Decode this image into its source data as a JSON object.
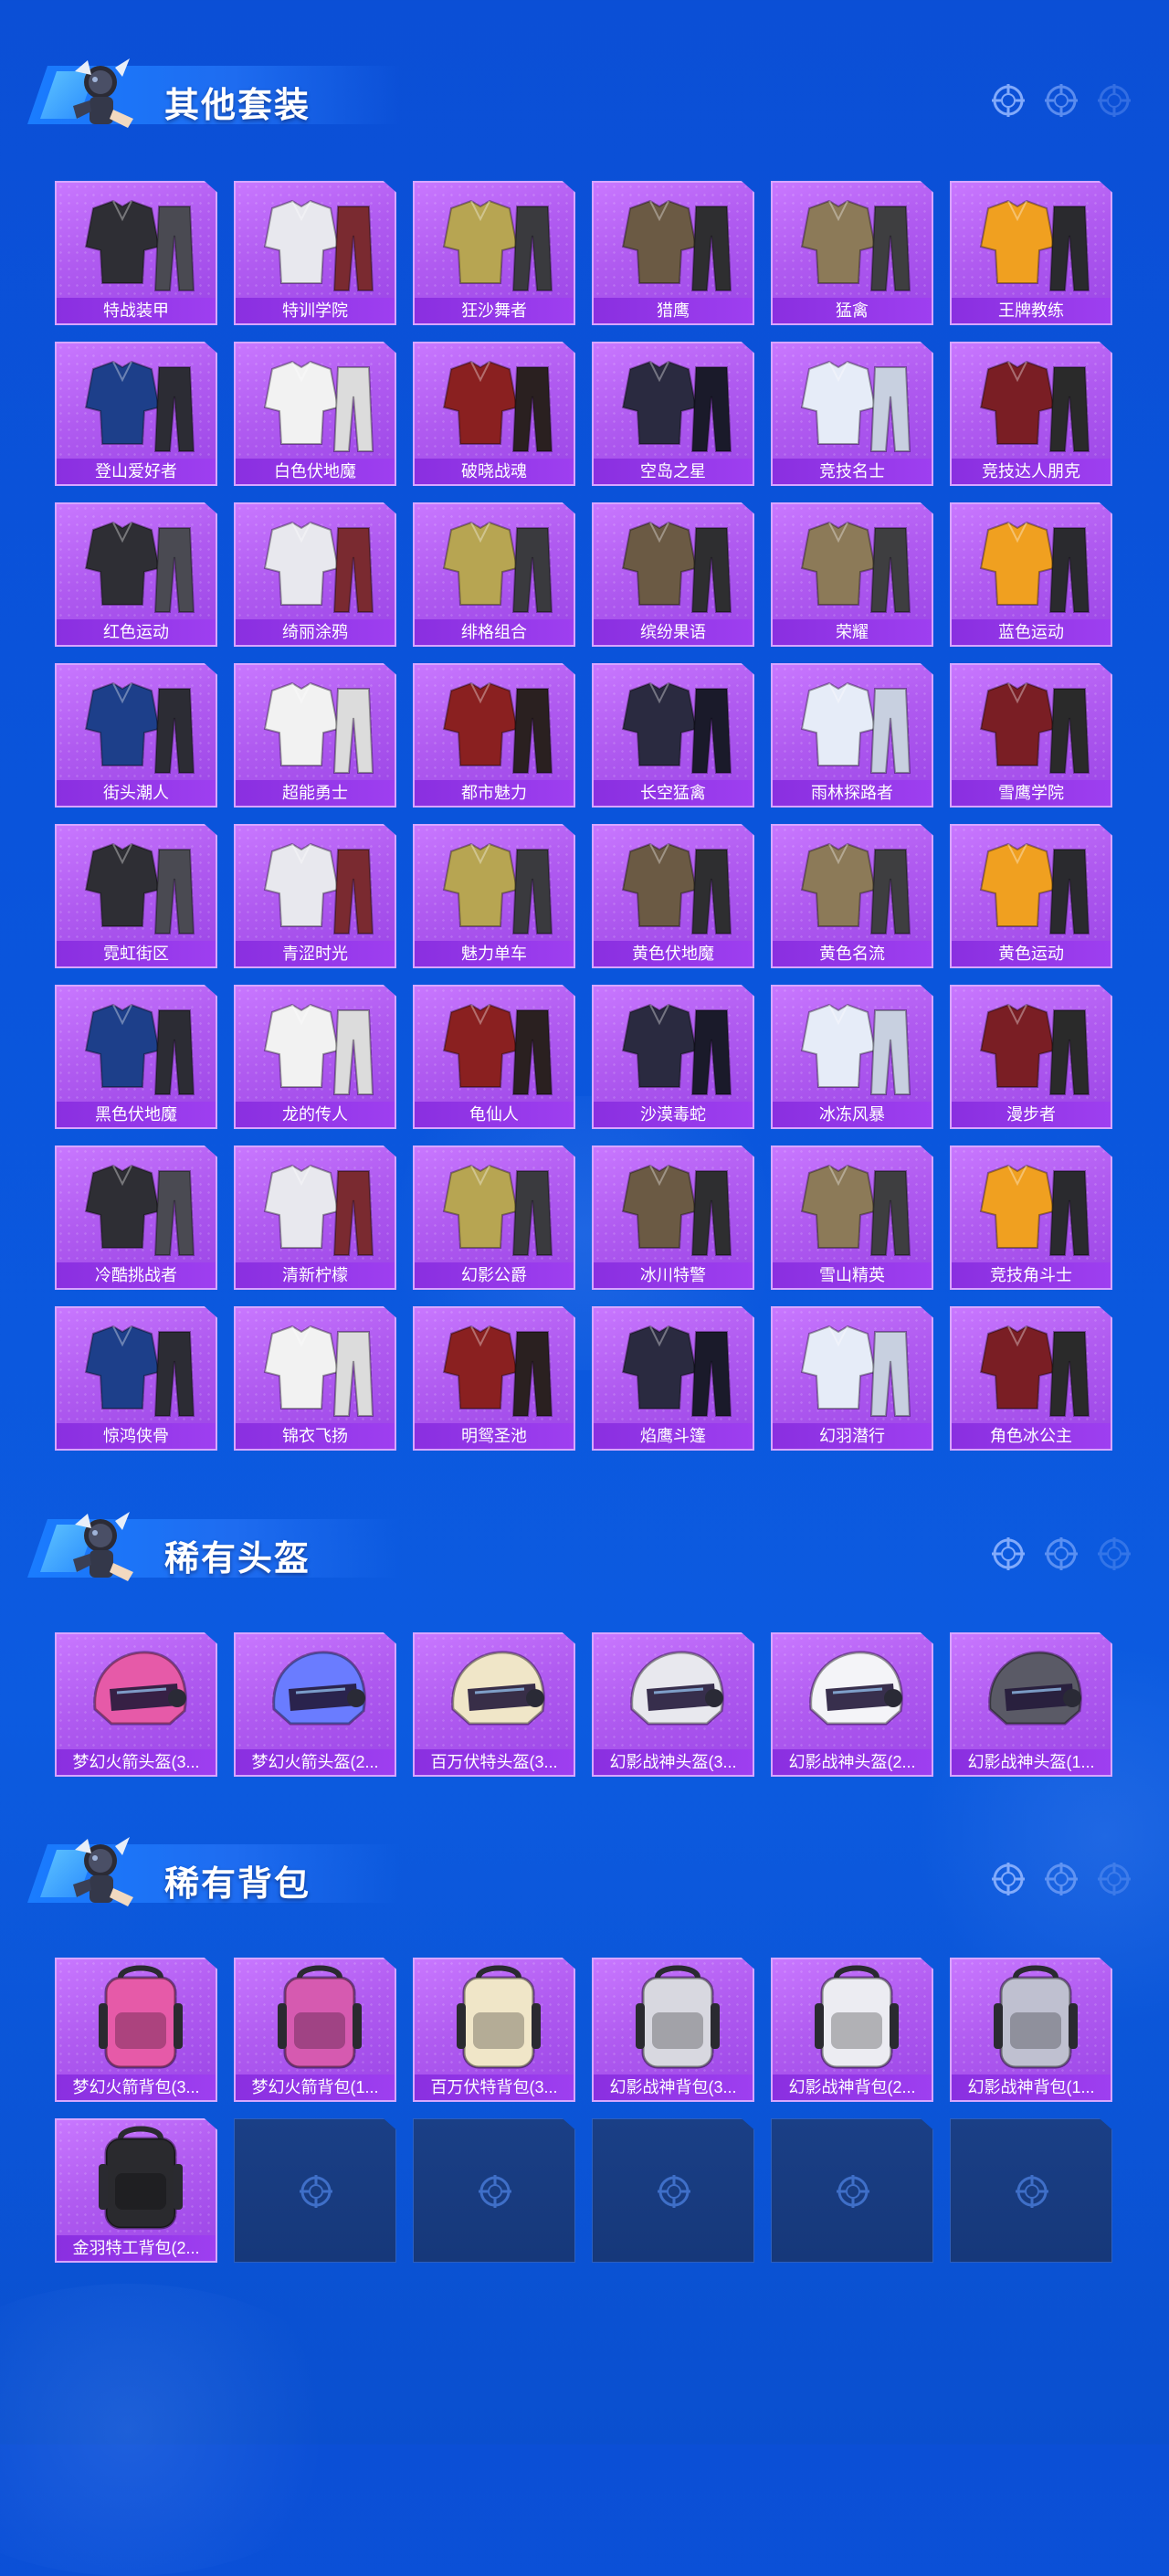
{
  "sections": [
    {
      "title": "其他套装",
      "items": [
        "特战装甲",
        "特训学院",
        "狂沙舞者",
        "猎鹰",
        "猛禽",
        "王牌教练",
        "登山爱好者",
        "白色伏地魔",
        "破晓战魂",
        "空岛之星",
        "竞技名士",
        "竞技达人朋克",
        "红色运动",
        "绮丽涂鸦",
        "绯格组合",
        "缤纷果语",
        "荣耀",
        "蓝色运动",
        "街头潮人",
        "超能勇士",
        "都市魅力",
        "长空猛禽",
        "雨林探路者",
        "雪鹰学院",
        "霓虹街区",
        "青涩时光",
        "魅力单车",
        "黄色伏地魔",
        "黄色名流",
        "黄色运动",
        "黑色伏地魔",
        "龙的传人",
        "龟仙人",
        "沙漠毒蛇",
        "冰冻风暴",
        "漫步者",
        "冷酷挑战者",
        "清新柠檬",
        "幻影公爵",
        "冰川特警",
        "雪山精英",
        "竞技角斗士",
        "惊鸿侠骨",
        "锦衣飞扬",
        "明鸳圣池",
        "焰鹰斗篷",
        "幻羽潜行",
        "角色冰公主"
      ]
    },
    {
      "title": "稀有头盔",
      "items": [
        "梦幻火箭头盔(3...",
        "梦幻火箭头盔(2...",
        "百万伏特头盔(3...",
        "幻影战神头盔(3...",
        "幻影战神头盔(2...",
        "幻影战神头盔(1..."
      ]
    },
    {
      "title": "稀有背包",
      "items": [
        "梦幻火箭背包(3...",
        "梦幻火箭背包(1...",
        "百万伏特背包(3...",
        "幻影战神背包(3...",
        "幻影战神背包(2...",
        "幻影战神背包(1...",
        "金羽特工背包(2..."
      ],
      "empty_slots": 5
    }
  ],
  "icons": {
    "mascot": "mascot-icon",
    "reticle": "crosshair-icon",
    "outfit": "outfit-icon",
    "helmet": "helmet-icon",
    "backpack": "backpack-icon"
  },
  "colors": {
    "background": "#0b4fd6",
    "card": "#b05bf0",
    "label": "#8a2fe0",
    "empty_slot": "#1a3f86"
  }
}
